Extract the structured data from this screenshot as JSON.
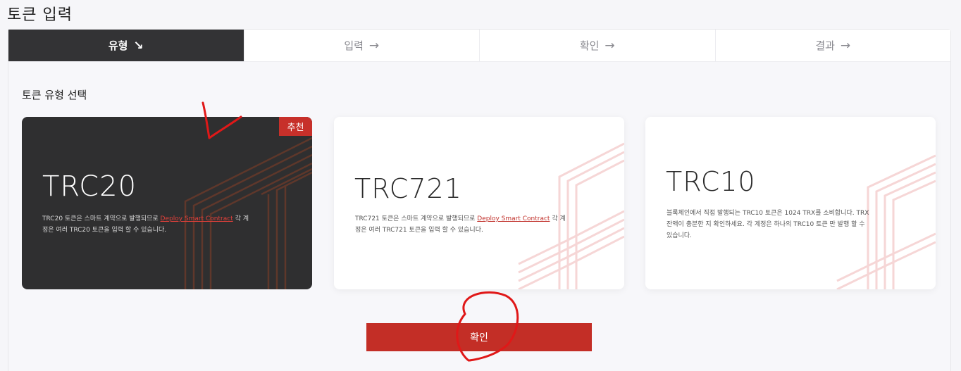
{
  "page": {
    "title": "토큰 입력"
  },
  "steps": [
    {
      "label": "유형",
      "arrow": "↘",
      "active": true
    },
    {
      "label": "입력",
      "arrow": "→",
      "active": false
    },
    {
      "label": "확인",
      "arrow": "→",
      "active": false
    },
    {
      "label": "결과",
      "arrow": "→",
      "active": false
    }
  ],
  "section": {
    "title": "토큰 유형 선택"
  },
  "cards": [
    {
      "logo": "TRC20",
      "badge": "추천",
      "desc_before": "TRC20 토큰은 스마트 계약으로 발행되므로 ",
      "link": "Deploy Smart Contract",
      "desc_after": " 각 계정은 여러 TRC20 토큰을 입력 할 수 있습니다."
    },
    {
      "logo": "TRC721",
      "desc_before": "TRC721 토큰은 스마트 계약으로 발행되므로 ",
      "link": "Deploy Smart Contract",
      "desc_after": " 각 계정은 여러 TRC721 토큰을 입력 할 수 있습니다."
    },
    {
      "logo": "TRC10",
      "desc": "블록체인에서 직접 발행되는 TRC10 토큰은 1024 TRX를 소비합니다. TRX 잔액이 충분한 지 확인하세요. 각 계정은 하나의 TRC10 토큰 만 발행 할 수 있습니다."
    }
  ],
  "confirm_button": {
    "label": "확인"
  },
  "colors": {
    "accent": "#c32e26",
    "dark_card": "#2f2f30",
    "annotation": "#e01818"
  }
}
